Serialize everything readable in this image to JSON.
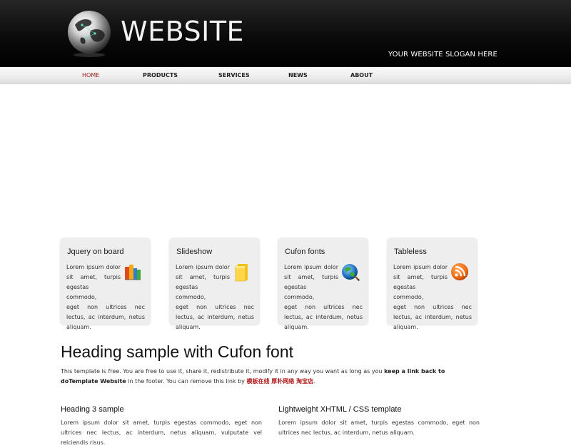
{
  "header": {
    "logo_text": "WEBSITE",
    "slogan": "YOUR WEBSITE SLOGAN HERE"
  },
  "nav": {
    "items": [
      {
        "label": "HOME",
        "active": true
      },
      {
        "label": "PRODUCTS"
      },
      {
        "label": "SERVICES"
      },
      {
        "label": "NEWS"
      },
      {
        "label": "ABOUT"
      }
    ]
  },
  "features": [
    {
      "title": "Jquery on board",
      "icon": "books-icon",
      "line1": "Lorem ipsum dolor",
      "line2": "sit amet, turpis",
      "line3": "egestas commodo,",
      "rest": "eget non ultrices nec lectus, ac interdum, netus aliquam."
    },
    {
      "title": "Slideshow",
      "icon": "folder-icon",
      "line1": "Lorem ipsum dolor",
      "line2": "sit amet, turpis",
      "line3": "egestas commodo,",
      "rest": "eget non ultrices nec lectus, ac interdum, netus aliquam."
    },
    {
      "title": "Cufon fonts",
      "icon": "globe-icon",
      "line1": "Lorem ipsum dolor",
      "line2": "sit amet, turpis",
      "line3": "egestas commodo,",
      "rest": "eget non ultrices nec lectus, ac interdum, netus aliquam."
    },
    {
      "title": "Tableless",
      "icon": "rss-icon",
      "line1": "Lorem ipsum dolor",
      "line2": "sit amet, turpis",
      "line3": "egestas commodo,",
      "rest": "eget non ultrices nec lectus, ac interdum, netus aliquam."
    }
  ],
  "main": {
    "heading": "Heading sample with Cufon font",
    "intro_text": "This template is free. You are free to use it, share it, redistribute it, modify it in any way you want as long as you",
    "intro_strong": "keep a link back to doTemplate Website",
    "intro_text2": "in the footer. You can remove this link by",
    "intro_link": "模板在线 厚朴网络 淘宝店",
    "intro_end": "."
  },
  "columns": [
    {
      "heading": "Heading 3 sample",
      "text": "Lorem ipsum dolor sit amet, turpis egestas commodo, eget non ultrices nec lectus, ac interdum, netus aliquam, vulputate vel reiciendis risus."
    },
    {
      "heading": "Lightweight XHTML / CSS template",
      "text": "Lorem ipsum dolor sit amet, turpis egestas commodo, eget non ultrices nec lectus, ac interdum, netus aliquam."
    }
  ],
  "colors": {
    "header_bg": "#000000",
    "nav_active": "#9b1c1c",
    "link_red": "#b01818",
    "box_bg": "#eeeeee"
  }
}
